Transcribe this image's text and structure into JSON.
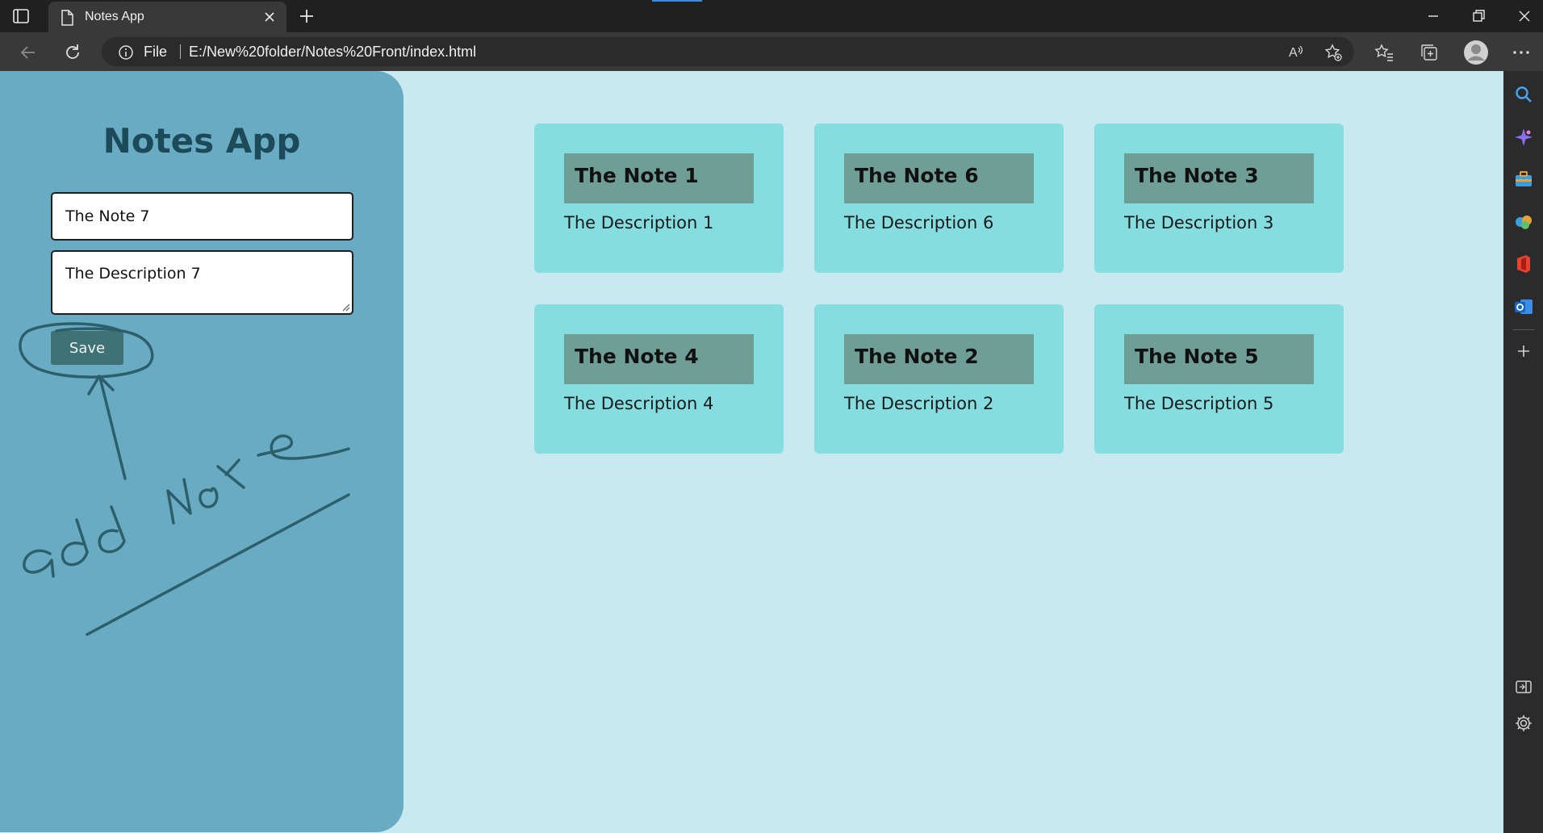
{
  "browser": {
    "tab_title": "Notes App",
    "address_prefix": "File",
    "url": "E:/New%20folder/Notes%20Front/index.html"
  },
  "app": {
    "title": "Notes App",
    "form": {
      "title_value": "The Note 7",
      "description_value": "The Description 7",
      "save_label": "Save"
    },
    "annotation_text": "add Note",
    "notes": [
      {
        "title": "The Note 1",
        "description": "The Description 1"
      },
      {
        "title": "The Note 6",
        "description": "The Description 6"
      },
      {
        "title": "The Note 3",
        "description": "The Description 3"
      },
      {
        "title": "The Note 4",
        "description": "The Description 4"
      },
      {
        "title": "The Note 2",
        "description": "The Description 2"
      },
      {
        "title": "The Note 5",
        "description": "The Description 5"
      }
    ]
  },
  "colors": {
    "page_background": "#c9e9f0",
    "side_panel": "#6aabc4",
    "title_text": "#1d4a59",
    "save_button": "#3e7275",
    "note_card": "#85dde0",
    "note_title_bg": "#6f9e97",
    "annotation_ink": "#2d5f6b"
  }
}
